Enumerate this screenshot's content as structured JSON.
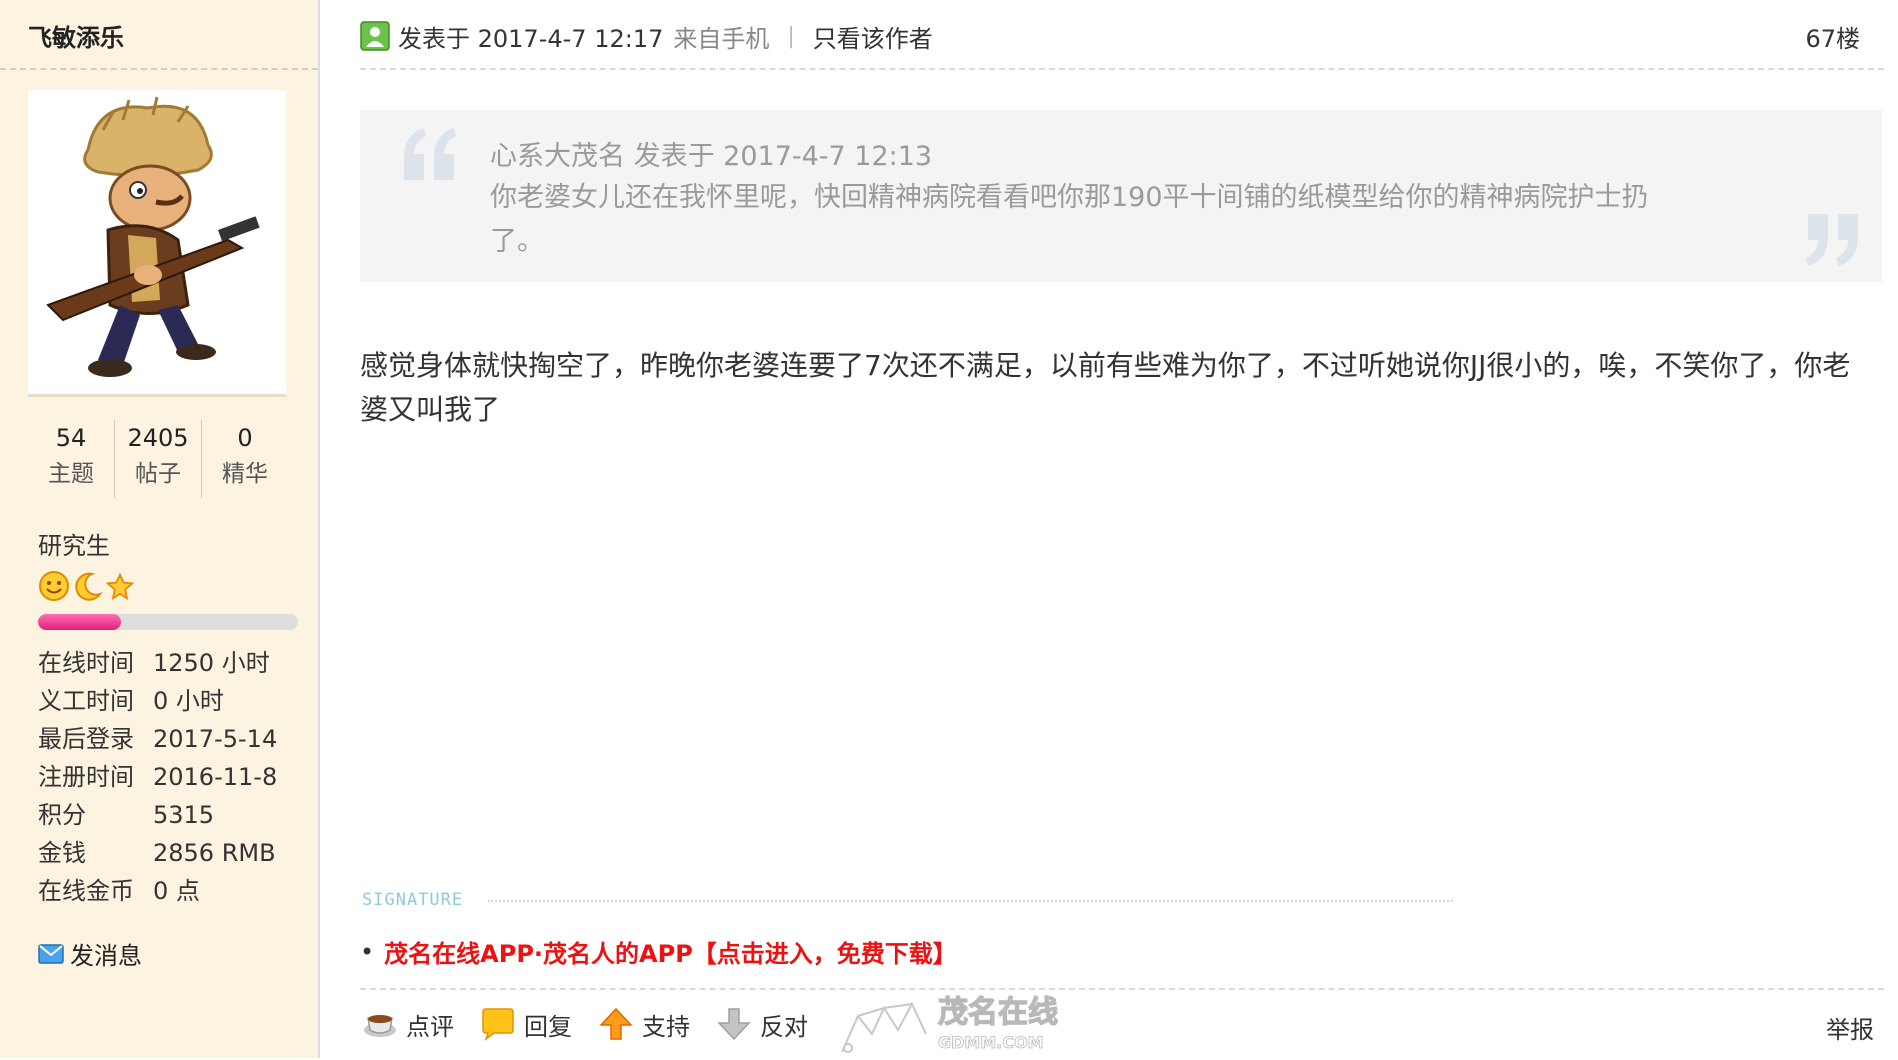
{
  "sidebar": {
    "username": "飞敏添乐",
    "stats": [
      {
        "num": "54",
        "label": "主题"
      },
      {
        "num": "2405",
        "label": "帖子"
      },
      {
        "num": "0",
        "label": "精华"
      }
    ],
    "rank_title": "研究生",
    "rank_icons": [
      "smiley-icon",
      "moon-icon",
      "star-icon"
    ],
    "level_progress_fraction": 0.32,
    "info": [
      {
        "key": "在线时间",
        "value": "1250 小时"
      },
      {
        "key": "义工时间",
        "value": "0 小时"
      },
      {
        "key": "最后登录",
        "value": "2017-5-14"
      },
      {
        "key": "注册时间",
        "value": "2016-11-8"
      },
      {
        "key": "积分",
        "value": "5315"
      },
      {
        "key": "金钱",
        "value": "2856 RMB"
      },
      {
        "key": "在线金币",
        "value": "0 点"
      }
    ],
    "message_label": "发消息"
  },
  "post": {
    "post_time": "发表于 2017-4-7 12:17",
    "from": "来自手机",
    "separator": "|",
    "only_author": "只看该作者",
    "floor": "67楼",
    "quote_header": "心系大茂名 发表于 2017-4-7 12:13",
    "quote_body": "你老婆女儿还在我怀里呢，快回精神病院看看吧你那190平十间铺的纸模型给你的精神病院护士扔了。",
    "body": "感觉身体就快掏空了，昨晚你老婆连要了7次还不满足，以前有些难为你了，不过听她说你JJ很小的，唉，不笑你了，你老婆又叫我了"
  },
  "signature": {
    "label": "SIGNATURE",
    "bullet": "•",
    "link_text": "茂名在线APP·茂名人的APP【点击进入，免费下载】"
  },
  "actions": {
    "comment": "点评",
    "reply": "回复",
    "support": "支持",
    "oppose": "反对",
    "report": "举报"
  },
  "watermark": {
    "brand": "茂名在线",
    "domain": "GDMM.COM"
  },
  "colors": {
    "sidebar_bg": "#fcf3e0",
    "quote_bg": "#f4f4f5",
    "signature_link": "#ee1111",
    "signature_label": "#8ecbdc",
    "progress_fill": "#e0207a"
  }
}
